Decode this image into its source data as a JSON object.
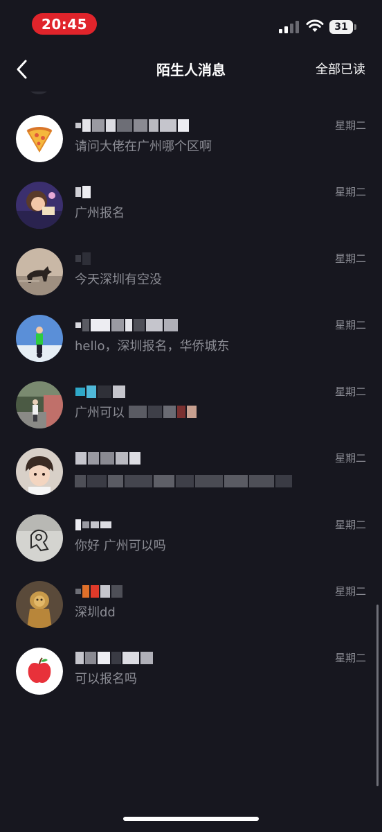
{
  "status_bar": {
    "time": "20:45",
    "battery": "31",
    "time_pill_color": "#e0242b"
  },
  "nav": {
    "back_icon": "chevron-left-icon",
    "title": "陌生人消息",
    "mark_all_read": "全部已读"
  },
  "conversations": [
    {
      "avatar": "pizza-icon",
      "preview": "请问大佬在广州哪个区啊",
      "time": "星期二"
    },
    {
      "avatar": "illustrated-girl-photo",
      "preview": "广州报名",
      "time": "星期二"
    },
    {
      "avatar": "cat-on-street-photo",
      "preview": "今天深圳有空没",
      "time": "星期二"
    },
    {
      "avatar": "person-outdoor-blue-sky-photo",
      "preview": "hello，深圳报名，华侨城东",
      "time": "星期二"
    },
    {
      "avatar": "person-on-steps-photo",
      "preview": "广州可以",
      "time": "星期二"
    },
    {
      "avatar": "cartoon-boy-portrait",
      "preview": "",
      "time": "星期二"
    },
    {
      "avatar": "sketch-drawing-photo",
      "preview": "你好 广州可以吗",
      "time": "星期二"
    },
    {
      "avatar": "golden-lion-statue-photo",
      "preview": "深圳dd",
      "time": "星期二"
    },
    {
      "avatar": "apple-icon",
      "preview": "可以报名吗",
      "time": "星期二"
    }
  ],
  "colors": {
    "background": "#17171f",
    "secondary_text": "#8b8c94",
    "primary_text": "#ffffff"
  }
}
